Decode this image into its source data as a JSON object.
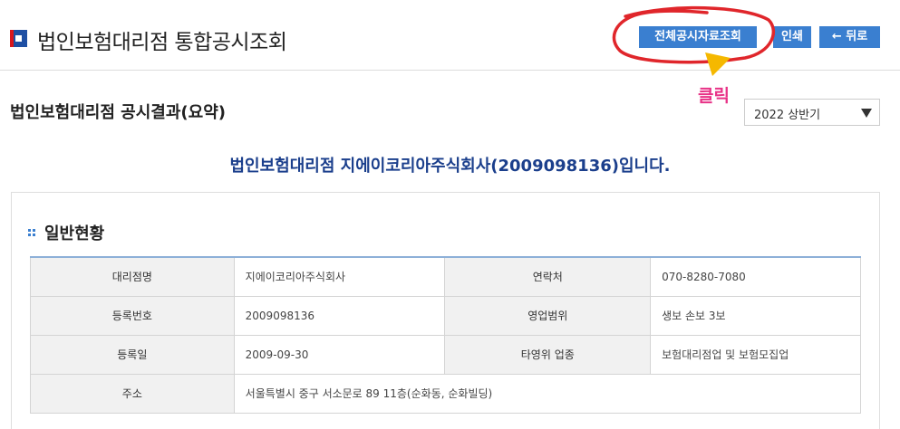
{
  "header": {
    "title": "법인보험대리점 통합공시조회",
    "buttons": {
      "all_disclosure": "전체공시자료조회",
      "print": "인쇄",
      "back": "← 뒤로"
    }
  },
  "annotation": {
    "label": "클릭",
    "color": "#e83287"
  },
  "summary": {
    "title": "법인보험대리점 공시결과(요약)",
    "period_select": {
      "value": "2022 상반기"
    }
  },
  "company_heading": "법인보험대리점 지에이코리아주식회사(2009098136)입니다.",
  "general": {
    "title": "일반현황",
    "rows": [
      {
        "label1": "대리점명",
        "value1": "지에이코리아주식회사",
        "label2": "연락처",
        "value2": "070-8280-7080"
      },
      {
        "label1": "등록번호",
        "value1": "2009098136",
        "label2": "영업범위",
        "value2": "생보 손보 3보"
      },
      {
        "label1": "등록일",
        "value1": "2009-09-30",
        "label2": "타영위 업종",
        "value2": "보험대리점업 및 보험모집업"
      }
    ],
    "address": {
      "label": "주소",
      "value": "서울특별시 중구 서소문로 89 11층(순화동, 순화빌딩)"
    }
  },
  "colors": {
    "accent": "#3a7fd0",
    "heading_blue": "#1b3f8c",
    "annotation_red": "#e0262b",
    "annotation_arrow": "#f5b800"
  }
}
